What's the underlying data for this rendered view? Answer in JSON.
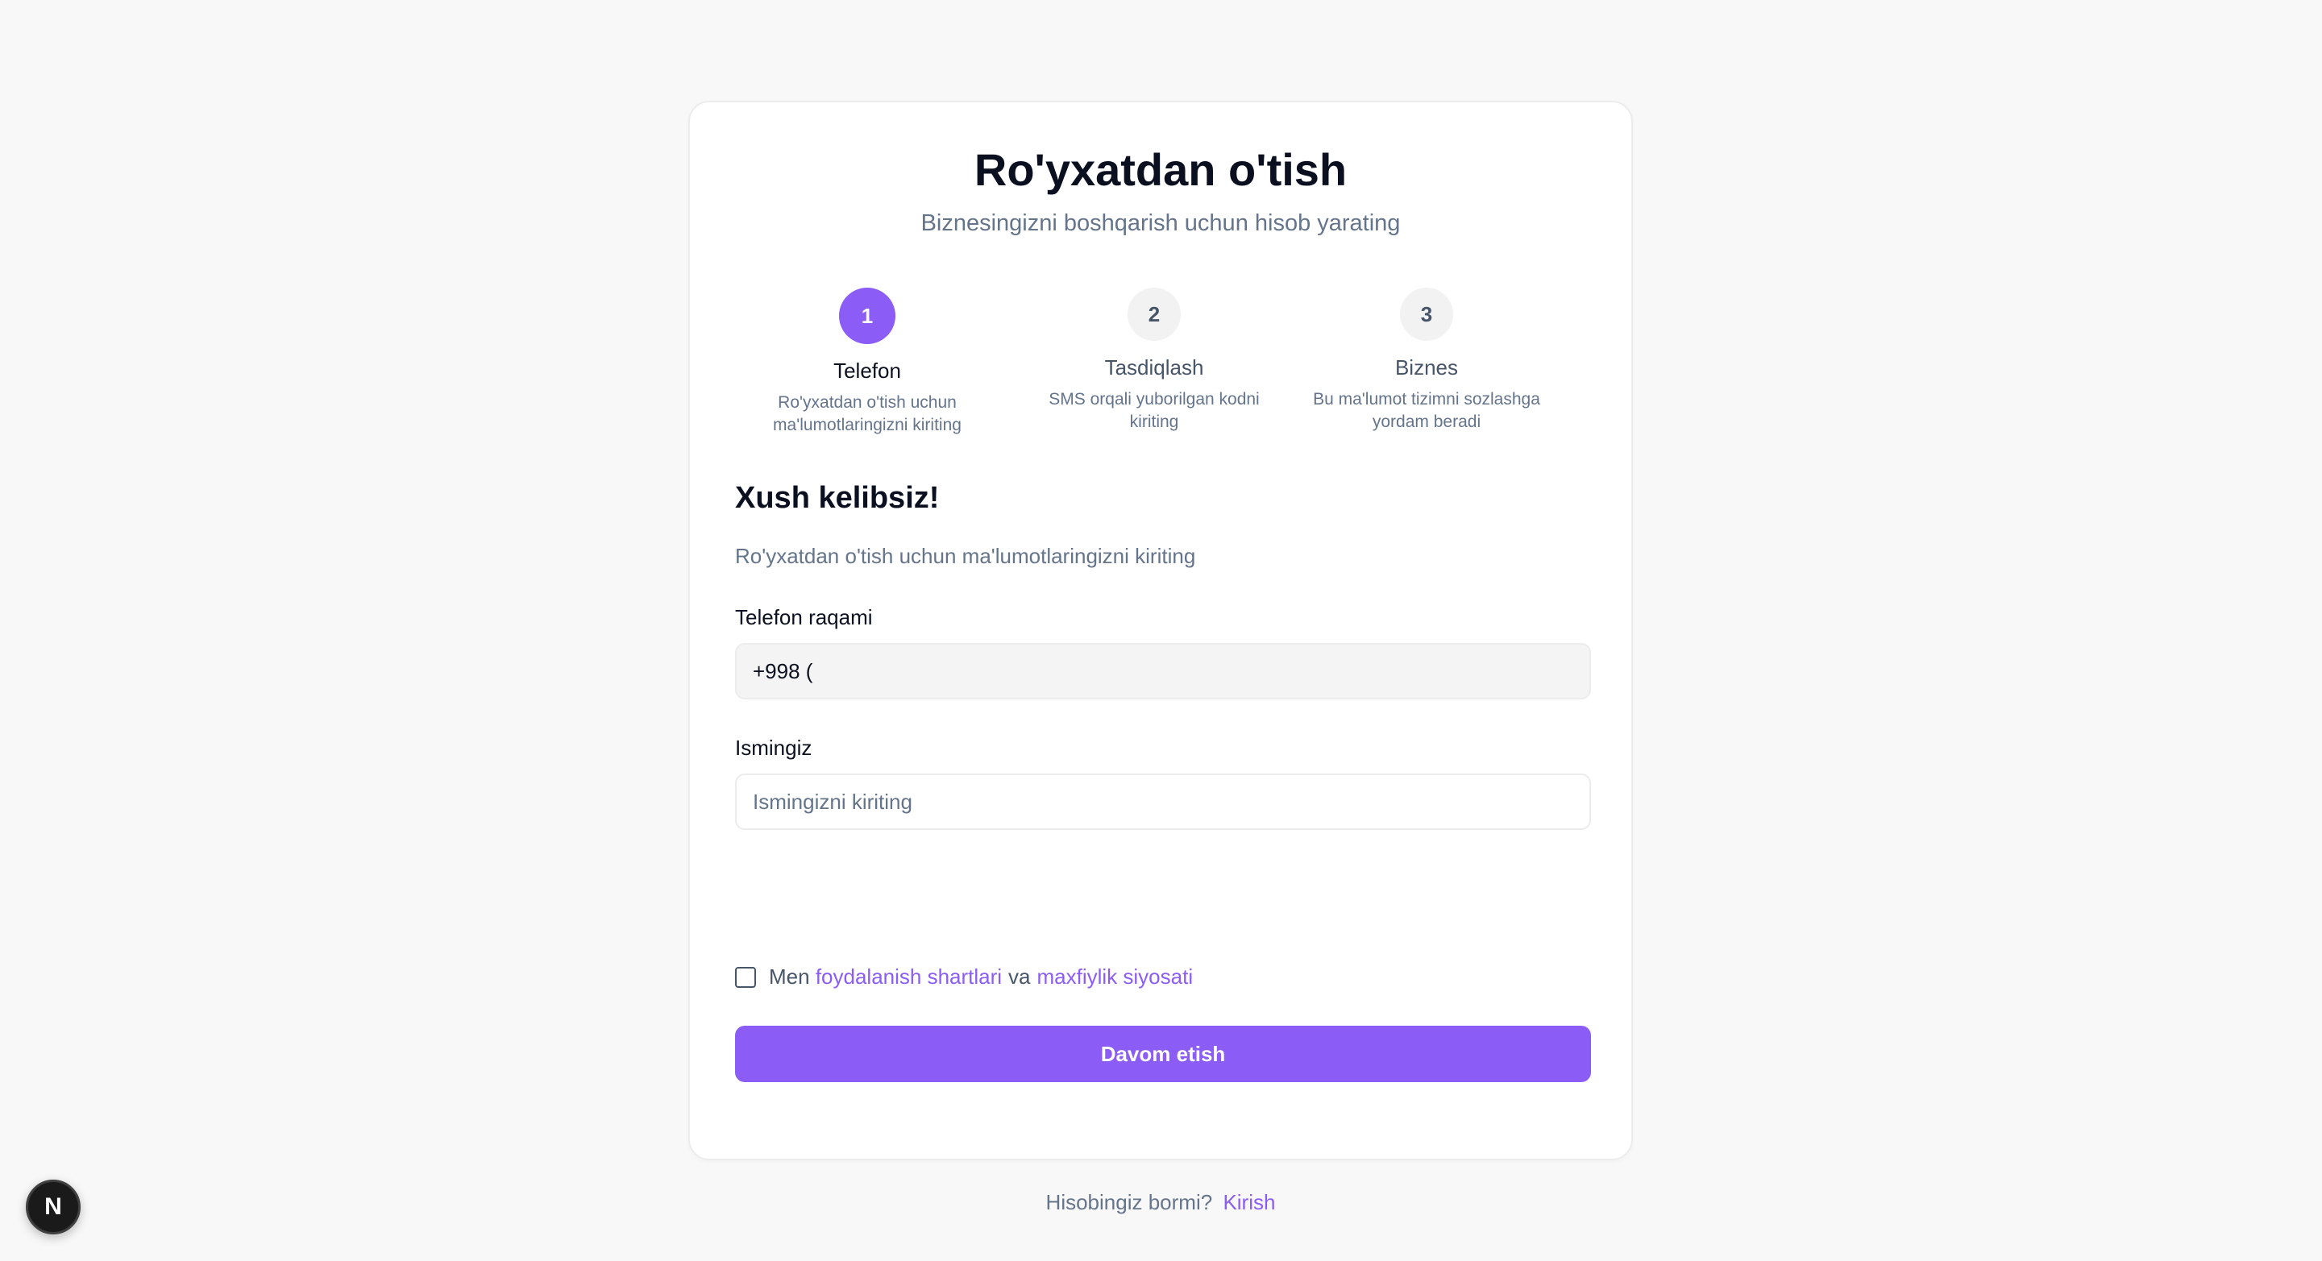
{
  "header": {
    "title": "Ro'yxatdan o'tish",
    "subtitle": "Biznesingizni boshqarish uchun hisob yarating"
  },
  "steps": [
    {
      "number": "1",
      "label": "Telefon",
      "description": "Ro'yxatdan o'tish uchun ma'lumotlaringizni kiriting",
      "active": true
    },
    {
      "number": "2",
      "label": "Tasdiqlash",
      "description": "SMS orqali yuborilgan kodni kiriting",
      "active": false
    },
    {
      "number": "3",
      "label": "Biznes",
      "description": "Bu ma'lumot tizimni sozlashga yordam beradi",
      "active": false
    }
  ],
  "form": {
    "heading": "Xush kelibsiz!",
    "description": "Ro'yxatdan o'tish uchun ma'lumotlaringizni kiriting",
    "phone": {
      "label": "Telefon raqami",
      "value": "+998 ("
    },
    "name": {
      "label": "Ismingiz",
      "value": "",
      "placeholder": "Ismingizni kiriting"
    },
    "terms": {
      "prefix": "Men",
      "terms_link": "foydalanish shartlari",
      "connector": "va",
      "privacy_link": "maxfiylik siyosati",
      "checked": false
    },
    "submit_label": "Davom etish"
  },
  "footer": {
    "question": "Hisobingiz bormi?",
    "login_link": "Kirish"
  },
  "dev_badge": {
    "letter": "N",
    "icon": "nextjs-icon"
  },
  "colors": {
    "accent": "#8b5cf6",
    "background": "#f8f8f8"
  }
}
